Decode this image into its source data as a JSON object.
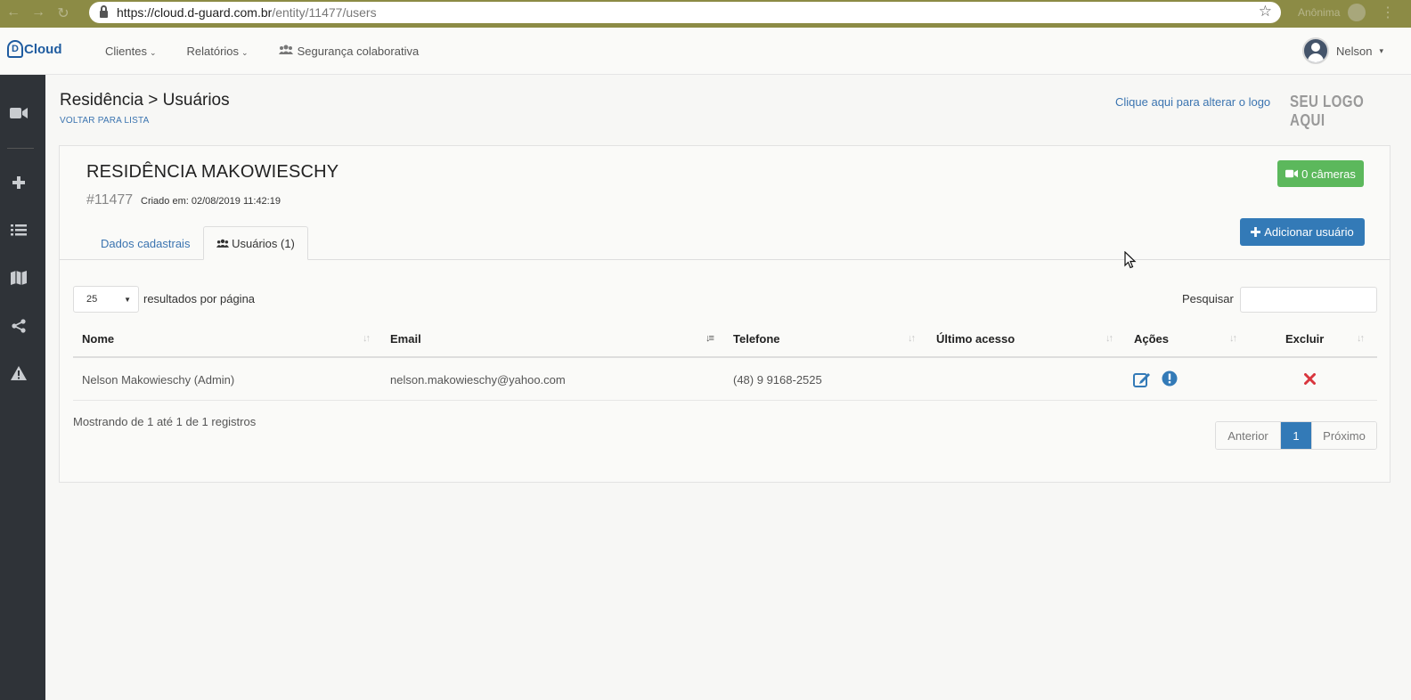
{
  "browser": {
    "url_host": "https://cloud.d-guard.com.br",
    "url_path": "/entity/11477/users",
    "incognito_label": "Anônima"
  },
  "app": {
    "logo_mark": "D",
    "logo_text": "Cloud",
    "nav": {
      "clients": "Clientes",
      "reports": "Relatórios",
      "security": "Segurança colaborativa"
    },
    "user_name": "Nelson"
  },
  "header": {
    "title": "Residência > Usuários",
    "back_link": "VOLTAR PARA LISTA",
    "change_logo": "Clique aqui para alterar o logo",
    "your_logo": "SEU LOGO AQUI"
  },
  "entity": {
    "name": "RESIDÊNCIA MAKOWIESCHY",
    "id": "#11477",
    "created": "Criado em: 02/08/2019 11:42:19",
    "cameras_button": "0 câmeras",
    "add_user_button": "Adicionar usuário"
  },
  "tabs": {
    "data": "Dados cadastrais",
    "users": "Usuários (1)"
  },
  "table_controls": {
    "page_length": "25",
    "page_length_label": "resultados por página",
    "search_label": "Pesquisar",
    "search_value": ""
  },
  "table": {
    "columns": {
      "name": "Nome",
      "email": "Email",
      "phone": "Telefone",
      "last_access": "Último acesso",
      "actions": "Ações",
      "delete": "Excluir"
    },
    "rows": [
      {
        "name": "Nelson Makowieschy (Admin)",
        "email": "nelson.makowieschy@yahoo.com",
        "phone": "(48) 9 9168-2525",
        "last_access": ""
      }
    ]
  },
  "footer": {
    "info": "Mostrando de 1 até 1 de 1 registros",
    "prev": "Anterior",
    "page": "1",
    "next": "Próximo"
  },
  "colors": {
    "primary": "#337ab7",
    "success": "#5cb85c",
    "danger": "#d9363e",
    "sidebar": "#2f3338"
  }
}
